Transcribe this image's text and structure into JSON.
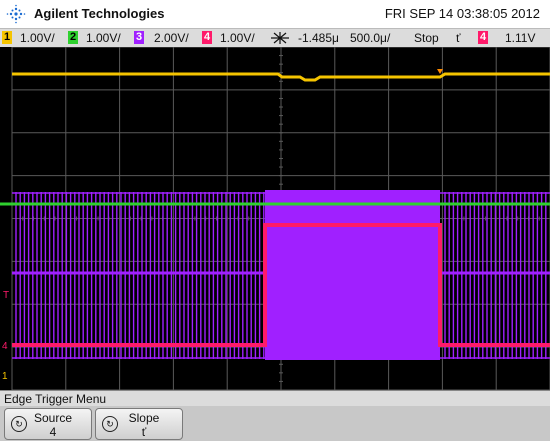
{
  "header": {
    "brand": "Agilent Technologies",
    "datetime": "FRI SEP 14 03:38:05 2012"
  },
  "channels": [
    {
      "number": "1",
      "scale": "1.00V/",
      "color": "#f5c400"
    },
    {
      "number": "2",
      "scale": "1.00V/",
      "color": "#2fd12f"
    },
    {
      "number": "3",
      "scale": "2.00V/",
      "color": "#a020ff"
    },
    {
      "number": "4",
      "scale": "1.00V/",
      "color": "#ff1a6a"
    }
  ],
  "timebase": {
    "icon": "trigger-position-icon",
    "delay": "-1.485μ",
    "scale": "500.0μ/"
  },
  "run_state": "Stop",
  "trigger": {
    "slope_symbol": "ť",
    "source": "4",
    "level": "1.11V"
  },
  "markers": {
    "trigger_level": "T",
    "ch4_ground": "4",
    "ch1_ground": "1"
  },
  "menu": {
    "title": "Edge Trigger Menu"
  },
  "softkeys": [
    {
      "label": "Source",
      "value": "4",
      "icon": "rotary-knob-icon"
    },
    {
      "label": "Slope",
      "value": "ť",
      "icon": "rotary-knob-icon"
    }
  ],
  "colors": {
    "ch1": "#f5c400",
    "ch2": "#2fd12f",
    "ch3": "#a020ff",
    "ch4": "#ff1a6a",
    "grid": "#5a5a5a"
  }
}
